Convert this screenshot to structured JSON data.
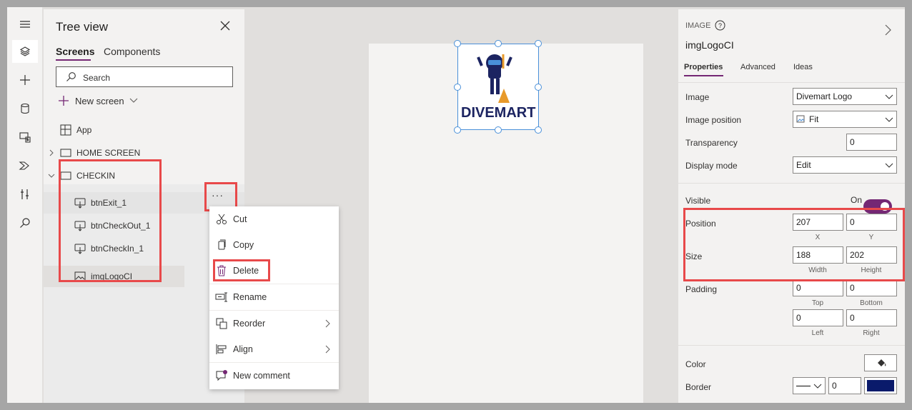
{
  "tree_panel": {
    "title": "Tree view",
    "tabs": [
      "Screens",
      "Components"
    ],
    "search_placeholder": "Search",
    "new_screen_label": "New screen",
    "items": {
      "app": "App",
      "home_screen": "HOME SCREEN",
      "checkin": "CHECKIN",
      "btn_exit": "btnExit_1",
      "btn_checkout": "btnCheckOut_1",
      "btn_checkin": "btnCheckIn_1",
      "img_logo": "imgLogoCI"
    },
    "more_button": "···"
  },
  "context_menu": {
    "cut": "Cut",
    "copy": "Copy",
    "delete": "Delete",
    "rename": "Rename",
    "reorder": "Reorder",
    "align": "Align",
    "new_comment": "New comment"
  },
  "canvas": {
    "logo_text": "DIVEMART"
  },
  "properties": {
    "control_type": "IMAGE",
    "control_name": "imgLogoCI",
    "tabs": [
      "Properties",
      "Advanced",
      "Ideas"
    ],
    "image_label": "Image",
    "image_value": "Divemart Logo",
    "image_position_label": "Image position",
    "image_position_value": "Fit",
    "transparency_label": "Transparency",
    "transparency_value": "0",
    "display_mode_label": "Display mode",
    "display_mode_value": "Edit",
    "visible_label": "Visible",
    "visible_value": "On",
    "position_label": "Position",
    "position_x": "207",
    "position_y": "0",
    "x_label": "X",
    "y_label": "Y",
    "size_label": "Size",
    "width_value": "188",
    "height_value": "202",
    "width_label": "Width",
    "height_label": "Height",
    "padding_label": "Padding",
    "padding_top": "0",
    "padding_bottom": "0",
    "padding_left": "0",
    "padding_right": "0",
    "top_label": "Top",
    "bottom_label": "Bottom",
    "left_label": "Left",
    "right_label": "Right",
    "color_label": "Color",
    "border_label": "Border",
    "border_width": "0"
  },
  "colors": {
    "accent": "#742774",
    "highlight_box": "#e8494a",
    "border_color": "#0a1a6b",
    "selection": "#4a90d9"
  }
}
